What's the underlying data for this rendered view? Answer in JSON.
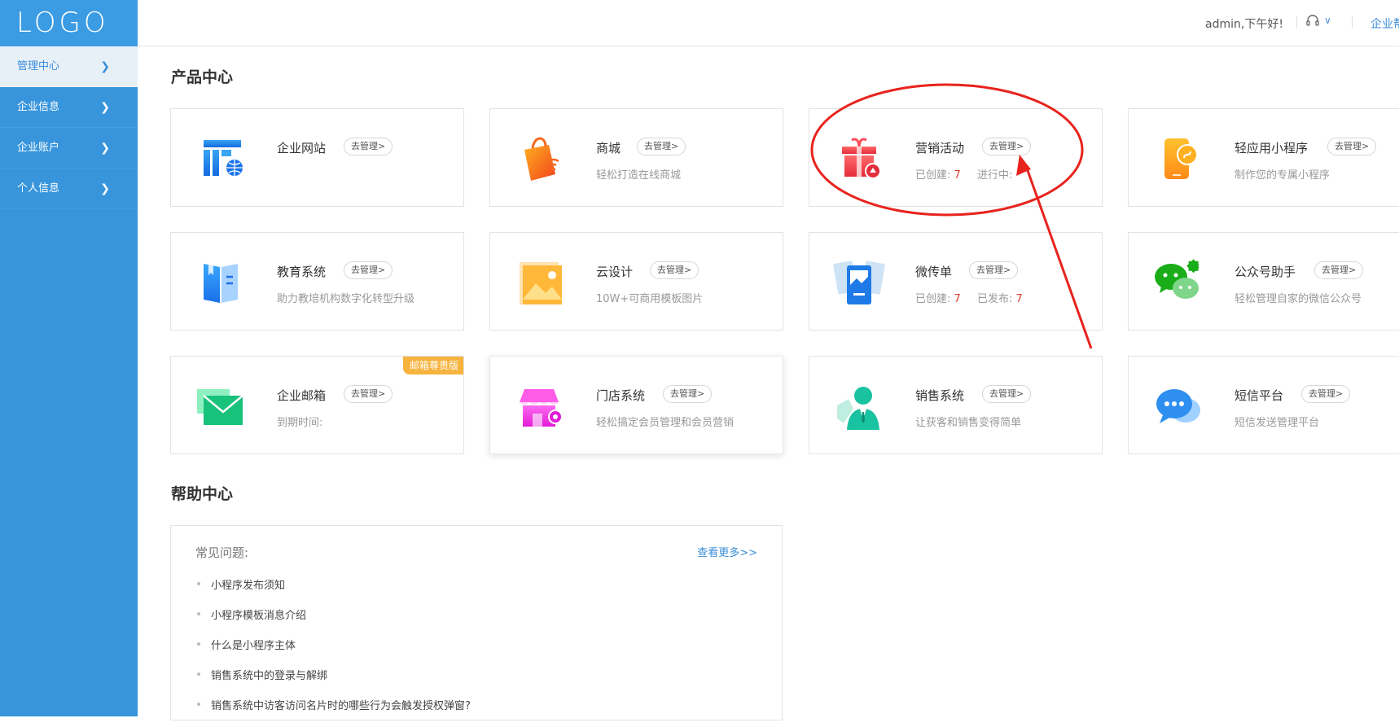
{
  "sidebar": {
    "logo": "LOGO",
    "items": [
      {
        "label": "管理中心"
      },
      {
        "label": "企业信息"
      },
      {
        "label": "企业账户"
      },
      {
        "label": "个人信息"
      }
    ]
  },
  "header": {
    "greeting": "admin,下午好!",
    "right_link": "企业帮"
  },
  "products": {
    "title": "产品中心",
    "manage_label": "去管理>",
    "cards": [
      {
        "name": "企业网站",
        "desc": ""
      },
      {
        "name": "商城",
        "desc": "轻松打造在线商城"
      },
      {
        "name": "营销活动",
        "stat1_label": "已创建:",
        "stat1_value": "7",
        "stat2_label": "进行中:"
      },
      {
        "name": "轻应用小程序",
        "desc": "制作您的专属小程序"
      },
      {
        "name": "教育系统",
        "desc": "助力教培机构数字化转型升级"
      },
      {
        "name": "云设计",
        "desc": "10W+可商用模板图片"
      },
      {
        "name": "微传单",
        "stat1_label": "已创建:",
        "stat1_value": "7",
        "stat2_label": "已发布:",
        "stat2_value": "7"
      },
      {
        "name": "公众号助手",
        "desc": "轻松管理自家的微信公众号"
      },
      {
        "name": "企业邮箱",
        "desc": "到期时间:",
        "badge": "邮箱尊贵版"
      },
      {
        "name": "门店系统",
        "desc": "轻松搞定会员管理和会员营销"
      },
      {
        "name": "销售系统",
        "desc": "让获客和销售变得简单"
      },
      {
        "name": "短信平台",
        "desc": "短信发送管理平台"
      }
    ]
  },
  "help": {
    "title": "帮助中心",
    "faq_title": "常见问题:",
    "more_label": "查看更多>>",
    "items": [
      "小程序发布须知",
      "小程序模板消息介绍",
      "什么是小程序主体",
      "销售系统中的登录与解绑",
      "销售系统中访客访问名片时的哪些行为会触发授权弹窗?"
    ]
  },
  "colors": {
    "sidebar": "#3895dc",
    "accent": "#3b8ed9",
    "highlight_number": "#e23b2e",
    "annotation": "#e8231d"
  }
}
